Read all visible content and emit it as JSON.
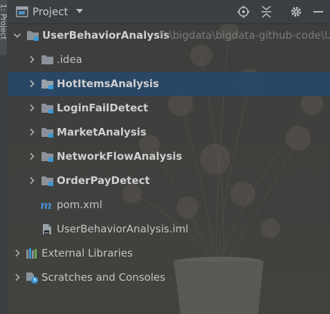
{
  "tool_window": {
    "side_tab_label": "1: Project"
  },
  "header": {
    "title": "Project",
    "icons": [
      "project-view-icon",
      "chevron-down-icon",
      "locate-icon",
      "collapse-all-icon",
      "gear-icon",
      "minimize-icon"
    ]
  },
  "tree": {
    "root": {
      "name": "UserBehaviorAnalysis",
      "path": "E:\\bigdata\\bigdata-github-code\\U"
    },
    "children": [
      {
        "name": ".idea",
        "kind": "folder"
      },
      {
        "name": "HotItemsAnalysis",
        "kind": "module",
        "selected": true
      },
      {
        "name": "LoginFailDetect",
        "kind": "module"
      },
      {
        "name": "MarketAnalysis",
        "kind": "module"
      },
      {
        "name": "NetworkFlowAnalysis",
        "kind": "module"
      },
      {
        "name": "OrderPayDetect",
        "kind": "module"
      },
      {
        "name": "pom.xml",
        "kind": "maven-file"
      },
      {
        "name": "UserBehaviorAnalysis.iml",
        "kind": "iml-file"
      }
    ],
    "external_libraries": "External Libraries",
    "scratches": "Scratches and Consoles"
  },
  "colors": {
    "panel_bg": "#3c3f41",
    "selection": "#274868",
    "folder": "#8b9299",
    "module_dot": "#3b99d4",
    "maven": "#4a8fd0"
  }
}
